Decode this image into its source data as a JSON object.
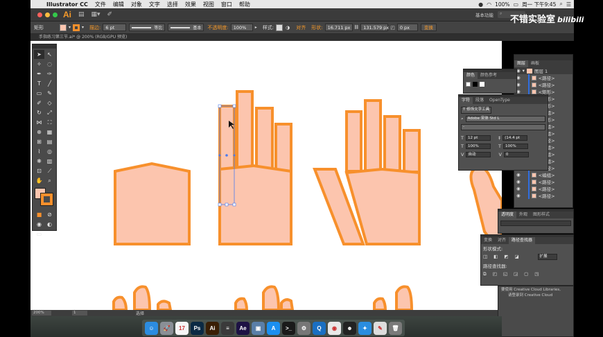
{
  "menubar": {
    "app_name": "Illustrator CC",
    "items": [
      "文件",
      "编辑",
      "对象",
      "文字",
      "选择",
      "效果",
      "视图",
      "窗口",
      "帮助"
    ],
    "battery": "100%",
    "clock": "周一 下午9:45"
  },
  "appbar": {
    "logo": "Ai",
    "workspace": "基本功能"
  },
  "controlbar": {
    "object_type": "矩形",
    "stroke_label": "描边:",
    "stroke_weight": "6 pt",
    "profile_label": "等比",
    "brush_label": "基本",
    "opacity_label": "不透明度:",
    "opacity_value": "100%",
    "style_label": "样式:",
    "align_label": "对齐",
    "shape_label": "形状:",
    "width_value": "16.711 px",
    "height_value": "131.579 px",
    "corner_value": "0 px",
    "transform_label": "变换"
  },
  "document_tab": "手指练习第三节.ai* @ 200% (RGB/GPU 预览)",
  "colors": {
    "fill": "#fcc5ae",
    "stroke": "#f7902c"
  },
  "panels": {
    "layers": {
      "tabs": [
        "图层",
        "画板"
      ],
      "layer_name": "图层 1",
      "rows": [
        "<路径>",
        "<路径>",
        "<矩形>",
        "<矩形>",
        "<矩形>",
        "<编组>",
        "<矩形>",
        "<编组>",
        "<编组>",
        "<路径>",
        "<编组>",
        "<编组>",
        "<编组>",
        "<路径>",
        "<编组>",
        "<路径>",
        "<路径>",
        "<路径>"
      ]
    },
    "color_guide": {
      "tabs": [
        "颜色",
        "颜色参考"
      ]
    },
    "character": {
      "tabs": [
        "字符",
        "段落",
        "OpenType"
      ],
      "touch_button": "修饰文字工具",
      "font_family": "Adobe 宋体 Std L",
      "font_style": "-",
      "size": "12 pt",
      "leading": "(14.4 pt",
      "scale_h": "100%",
      "scale_v": "100%",
      "kerning": "自动",
      "tracking": "0"
    },
    "stroke_panel": {
      "tabs": [
        "透明度",
        "外观",
        "图形样式"
      ]
    },
    "pathfinder": {
      "tabs": [
        "变换",
        "对齐",
        "路径查找器"
      ],
      "shape_modes_label": "形状模式:",
      "pathfinders_label": "路径查找器:",
      "expand_label": "扩展"
    },
    "libraries": {
      "line1": "要使用 Creative Cloud Libraries,",
      "line2": "请登录到 Creative Cloud"
    }
  },
  "statusbar": {
    "zoom": "200%",
    "artboard": "1",
    "mode": "选择"
  },
  "dock": [
    {
      "name": "finder-icon",
      "label": "☺",
      "bg": "#2c8ce0"
    },
    {
      "name": "launchpad-icon",
      "label": "🚀",
      "bg": "#8a8f96"
    },
    {
      "name": "calendar-icon",
      "label": "17",
      "bg": "#f5f5f5"
    },
    {
      "name": "photoshop-icon",
      "label": "Ps",
      "bg": "#0b2a44"
    },
    {
      "name": "illustrator-icon",
      "label": "Ai",
      "bg": "#3a1f05"
    },
    {
      "name": "indesign-icon",
      "label": "≡",
      "bg": "#3a3a3a"
    },
    {
      "name": "after-effects-icon",
      "label": "Ae",
      "bg": "#1d1244"
    },
    {
      "name": "preview-icon",
      "label": "▣",
      "bg": "#5a7fa8"
    },
    {
      "name": "app-store-icon",
      "label": "A",
      "bg": "#1b8ff0"
    },
    {
      "name": "terminal-icon",
      "label": ">_",
      "bg": "#1a1a1a"
    },
    {
      "name": "system-prefs-icon",
      "label": "⚙",
      "bg": "#777"
    },
    {
      "name": "quicktime-icon",
      "label": "Q",
      "bg": "#1a6fc2"
    },
    {
      "name": "chrome-icon",
      "label": "◉",
      "bg": "#e8e8e8"
    },
    {
      "name": "qq-icon",
      "label": "☻",
      "bg": "#222"
    },
    {
      "name": "safari-icon",
      "label": "✦",
      "bg": "#2a8de0"
    },
    {
      "name": "textedit-icon",
      "label": "✎",
      "bg": "#ddd"
    },
    {
      "name": "trash-icon",
      "label": "🗑",
      "bg": "#7a7a7a"
    }
  ],
  "watermark": {
    "text": "不错实验室",
    "brand": "bilibili"
  }
}
